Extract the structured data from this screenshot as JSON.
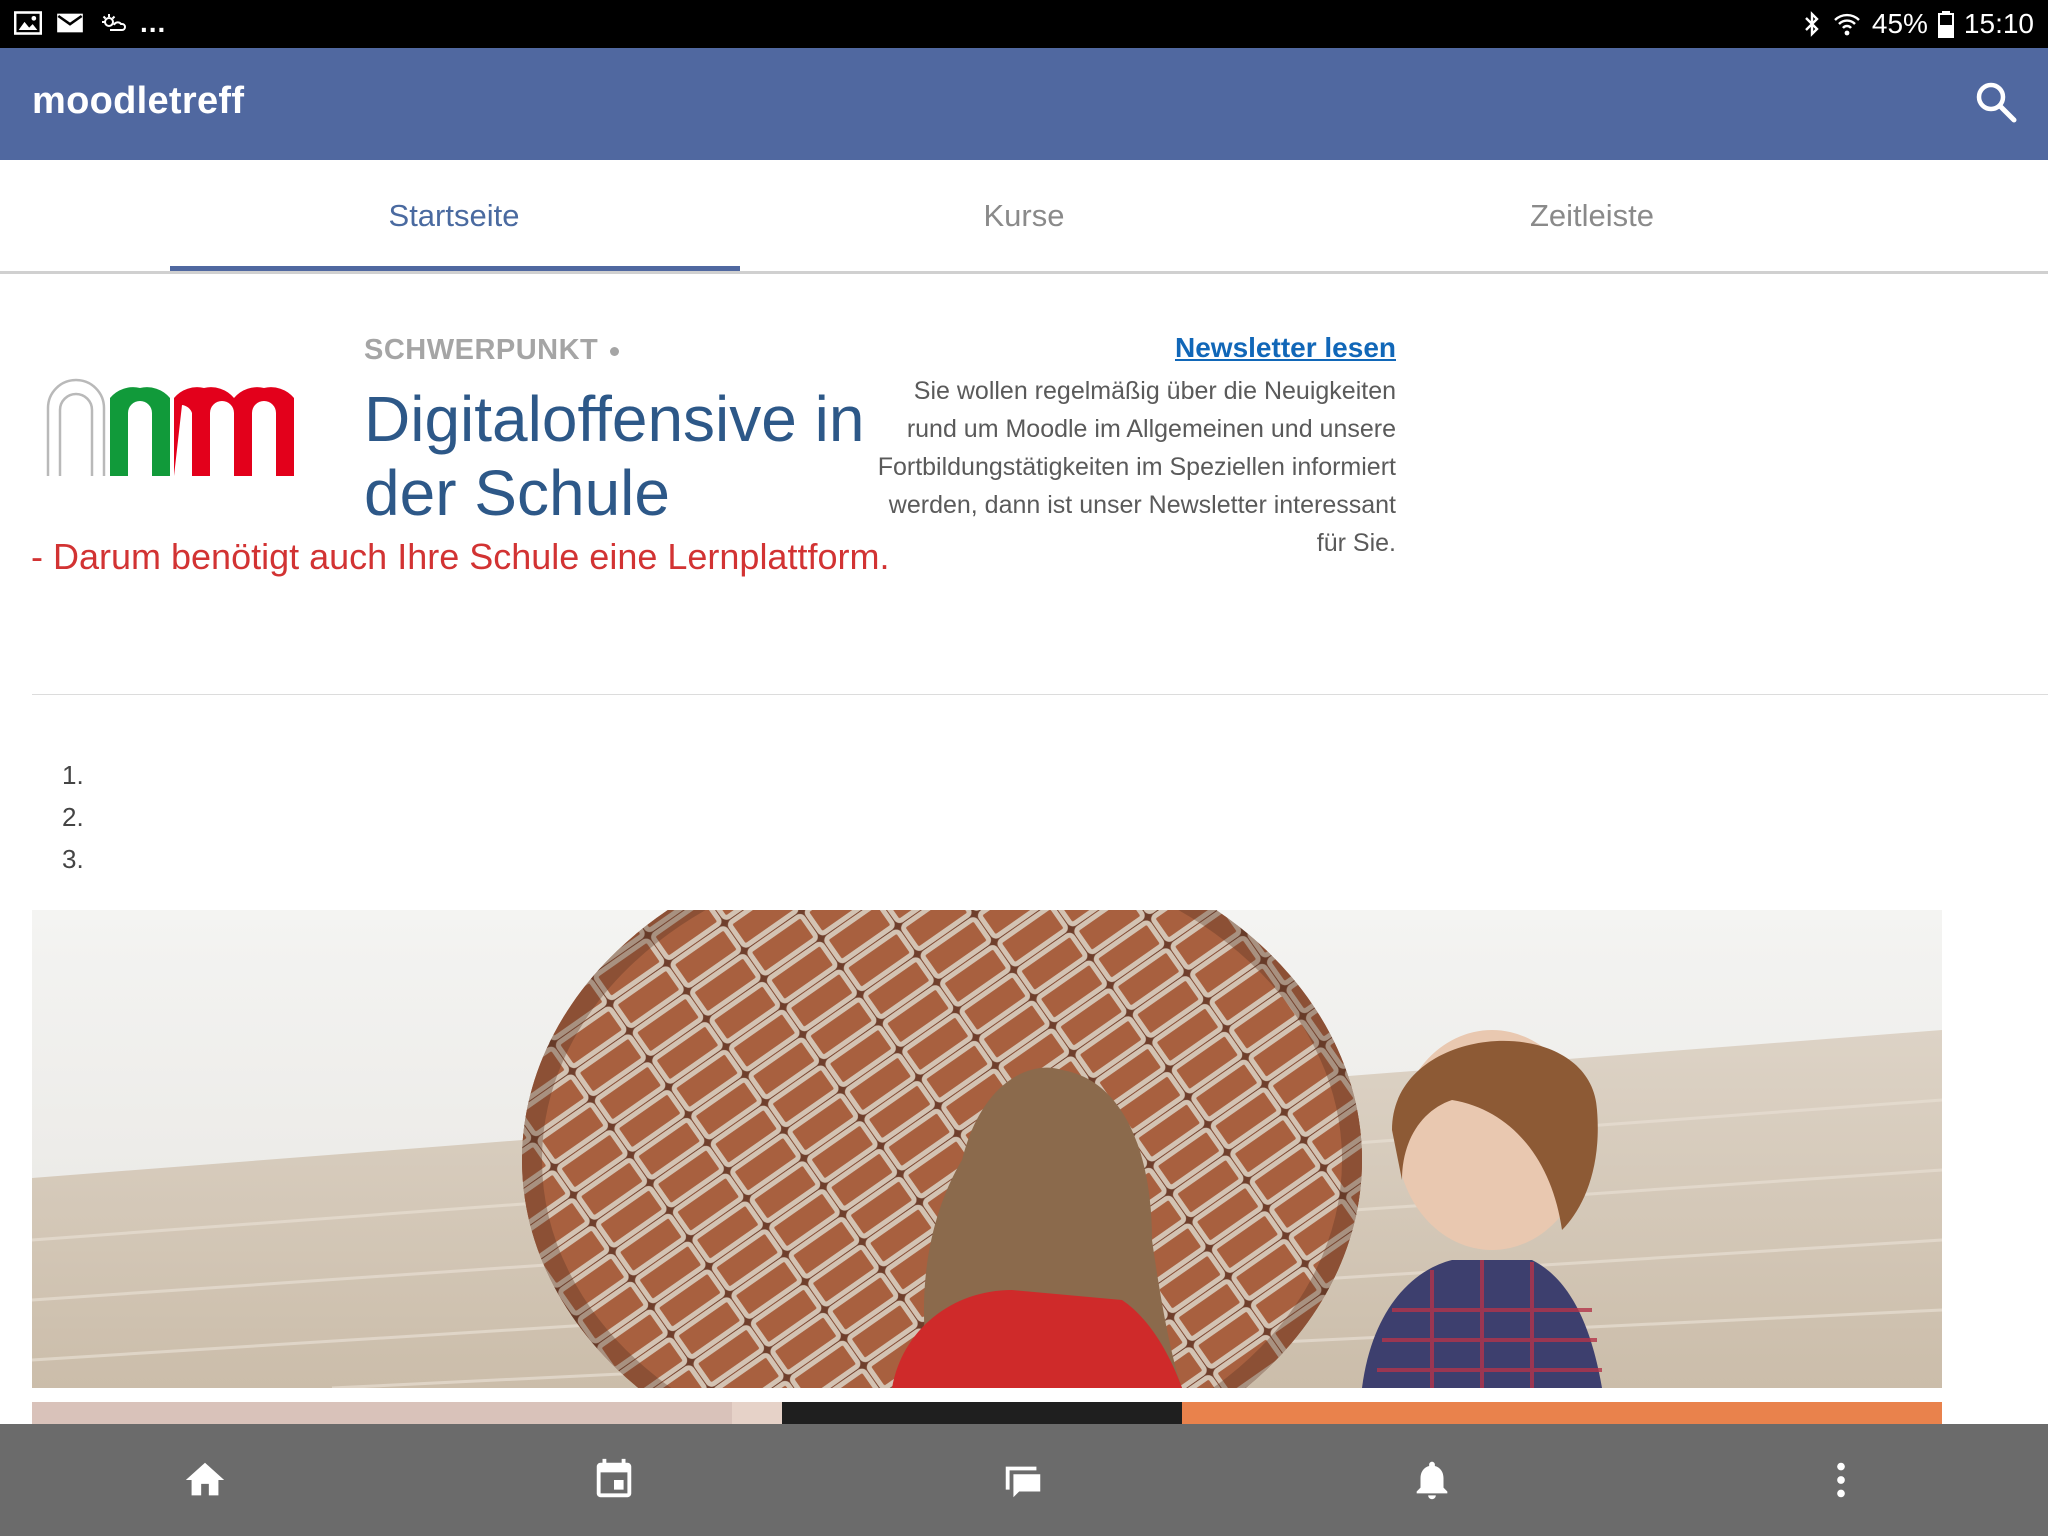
{
  "status_bar": {
    "icons_left": [
      "image-icon",
      "mail-icon",
      "weather-icon"
    ],
    "overflow_text": "...",
    "battery_percent": "45%",
    "time": "15:10"
  },
  "app_bar": {
    "title": "moodletreff",
    "search_icon": "search-icon"
  },
  "tabs": [
    {
      "label": "Startseite",
      "active": true
    },
    {
      "label": "Kurse",
      "active": false
    },
    {
      "label": "Zeitleiste",
      "active": false
    }
  ],
  "hero": {
    "kicker": "SCHWERPUNKT",
    "headline": "Digitaloffensive in der Schule",
    "subline": "- Darum benötigt auch Ihre Schule eine Lernplattform."
  },
  "newsletter": {
    "link_label": "Newsletter lesen",
    "text": "Sie wollen regelmäßig über die Neuigkeiten rund um Moodle im Allgemeinen und unsere Fortbildungstätigkeiten im Speziellen informiert werden, dann ist unser Newsletter interessant für Sie."
  },
  "carousel_indicators": [
    "1.",
    "2.",
    "3."
  ],
  "bottom_nav": [
    {
      "icon": "home-icon"
    },
    {
      "icon": "calendar-icon"
    },
    {
      "icon": "messages-icon"
    },
    {
      "icon": "bell-icon"
    },
    {
      "icon": "more-icon"
    }
  ],
  "colors": {
    "app_bar": "#5068a0",
    "headline": "#2d5888",
    "subline": "#d23333",
    "link": "#1167b8",
    "bottom_nav": "#6b6b6b",
    "logo_green": "#119a3a",
    "logo_red": "#e3001b"
  }
}
